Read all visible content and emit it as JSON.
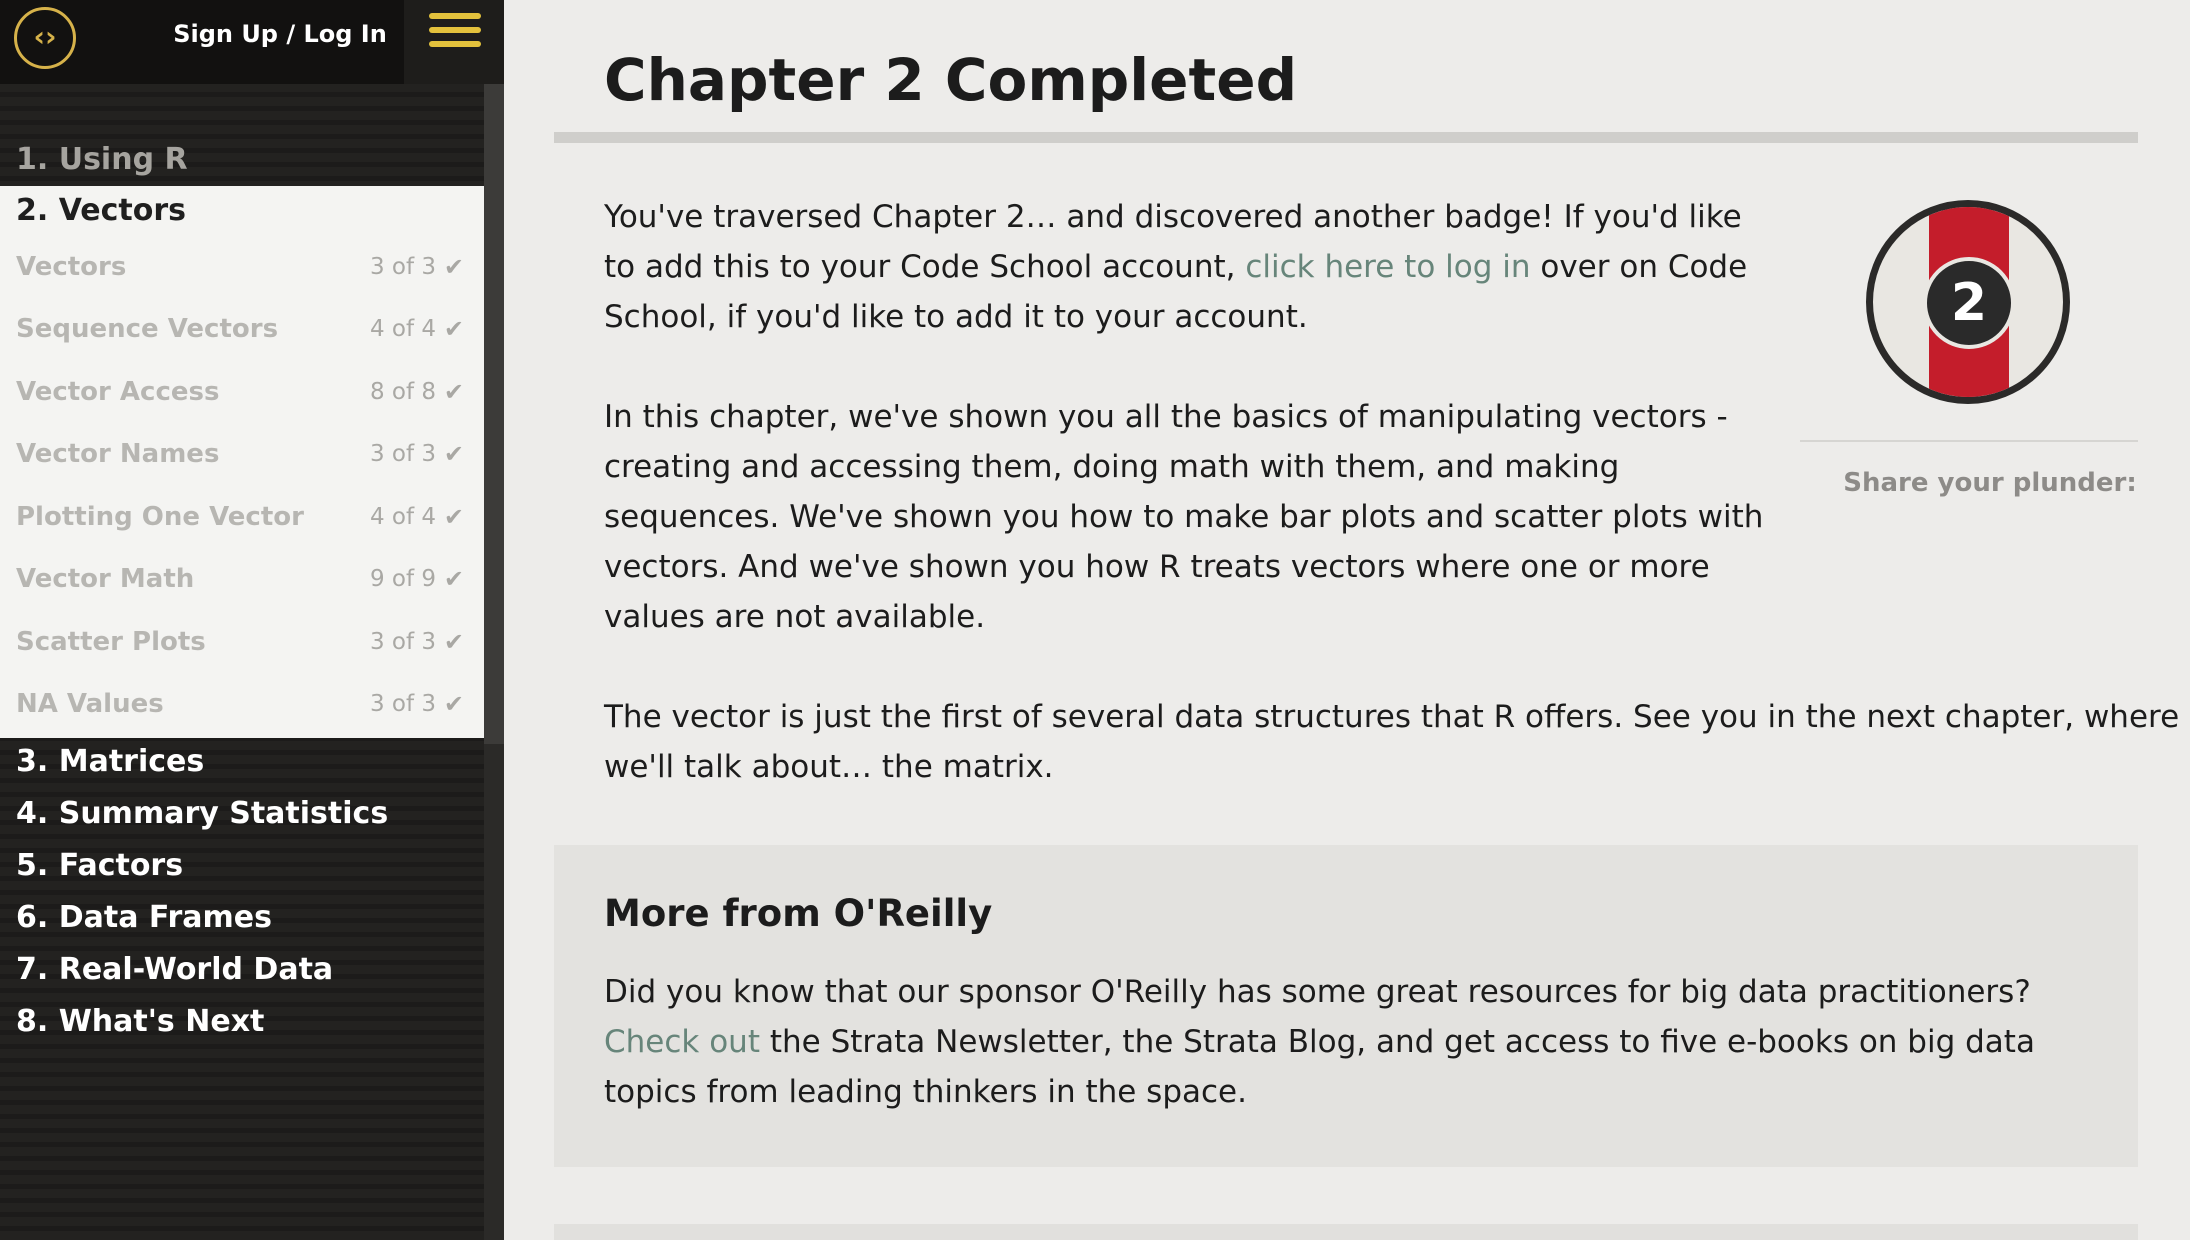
{
  "topbar": {
    "auth_label": "Sign Up / Log In",
    "logo_icon": "code-brackets-logo-icon",
    "menu_icon": "hamburger-menu-icon",
    "accent_color": "#d6b24a"
  },
  "sidebar": {
    "chapters": [
      {
        "label": "1. Using R"
      },
      {
        "label": "2. Vectors"
      },
      {
        "label": "3. Matrices"
      },
      {
        "label": "4. Summary Statistics"
      },
      {
        "label": "5. Factors"
      },
      {
        "label": "6. Data Frames"
      },
      {
        "label": "7. Real-World Data"
      },
      {
        "label": "8. What's Next"
      }
    ],
    "lessons": [
      {
        "name": "Vectors",
        "progress": "3 of 3"
      },
      {
        "name": "Sequence Vectors",
        "progress": "4 of 4"
      },
      {
        "name": "Vector Access",
        "progress": "8 of 8"
      },
      {
        "name": "Vector Names",
        "progress": "3 of 3"
      },
      {
        "name": "Plotting One Vector",
        "progress": "4 of 4"
      },
      {
        "name": "Vector Math",
        "progress": "9 of 9"
      },
      {
        "name": "Scatter Plots",
        "progress": "3 of 3"
      },
      {
        "name": "NA Values",
        "progress": "3 of 3"
      }
    ],
    "check_glyph": "✔"
  },
  "main": {
    "title": "Chapter 2 Completed",
    "para1_before": "You've traversed Chapter 2… and discovered another badge! If you'd like to add this to your Code School account, ",
    "para1_link": "click here to log in",
    "para1_after": " over on Code School, if you'd like to add it to your account.",
    "para2": "In this chapter, we've shown you all the basics of manipulating vectors - creating and accessing them, doing math with them, and making sequences. We've shown you how to make bar plots and scatter plots with vectors. And we've shown you how R treats vectors where one or more values are not available.",
    "para3": "The vector is just the first of several data structures that R offers. See you in the next chapter, where we'll talk about… the matrix.",
    "link_color": "#67857a",
    "badge": {
      "number": "2",
      "stripe_color": "#c41d2b"
    },
    "share_label": "Share your plunder:"
  },
  "oreilly": {
    "title": "More from O'Reilly",
    "text_before": "Did you know that our sponsor O'Reilly has some great resources for big data practitioners? ",
    "link": "Check out",
    "text_after": " the Strata Newsletter, the Strata Blog, and get access to five e-books on big data topics from leading thinkers in the space."
  }
}
